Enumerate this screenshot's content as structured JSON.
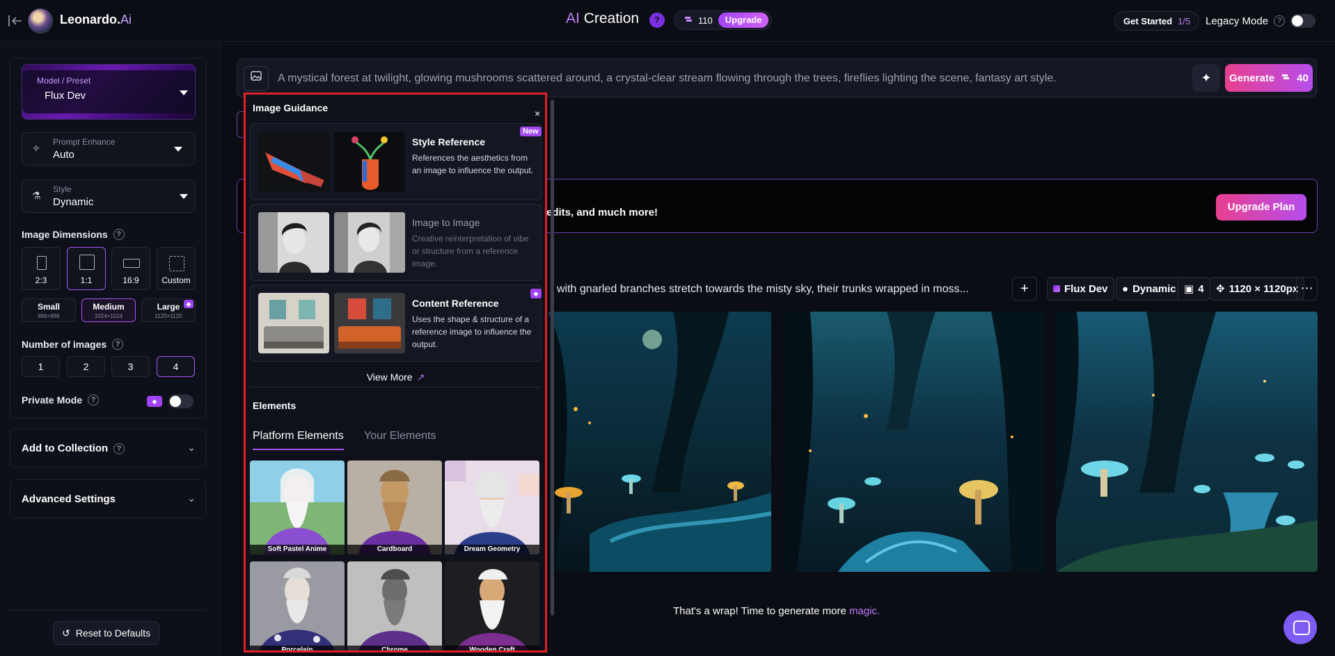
{
  "header": {
    "brand_name": "Leonardo.",
    "brand_ai": "Ai",
    "center_ai": "AI",
    "center_title": "Creation",
    "help_label": "?",
    "token_count": "110",
    "upgrade_label": "Upgrade",
    "get_started_label": "Get Started",
    "get_started_progress": "1/5",
    "legacy_mode_label": "Legacy Mode"
  },
  "sidebar": {
    "model_label": "Model / Preset",
    "model_value": "Flux Dev",
    "prompt_enhance_label": "Prompt Enhance",
    "prompt_enhance_value": "Auto",
    "style_label": "Style",
    "style_value": "Dynamic",
    "image_dimensions_label": "Image Dimensions",
    "aspects": [
      "2:3",
      "1:1",
      "16:9",
      "Custom"
    ],
    "selected_aspect": "1:1",
    "sizes": [
      {
        "name": "Small",
        "dims": "896×896"
      },
      {
        "name": "Medium",
        "dims": "1024×1024"
      },
      {
        "name": "Large",
        "dims": "1120×1120"
      }
    ],
    "selected_size": "Medium",
    "number_of_images_label": "Number of images",
    "numbers": [
      "1",
      "2",
      "3",
      "4"
    ],
    "selected_number": "4",
    "private_mode_label": "Private Mode",
    "add_to_collection_label": "Add to Collection",
    "advanced_settings_label": "Advanced Settings",
    "reset_label": "Reset to Defaults"
  },
  "prompt": {
    "text": "A mystical forest at twilight, glowing mushrooms scattered around, a crystal-clear stream flowing through the trees, fireflies lighting the scene, fantasy art style.",
    "generate_label": "Generate",
    "generate_cost": "40"
  },
  "promo": {
    "text": "edits, and much more!",
    "button_label": "Upgrade Plan"
  },
  "generation": {
    "prompt_text": "with gnarled branches stretch towards the misty sky, their trunks wrapped in moss...",
    "model_chip": "Flux Dev",
    "style_chip": "Dynamic",
    "count_chip": "4",
    "size_chip": "1120 × 1120px",
    "wrap_text": "That's a wrap! Time to generate more ",
    "wrap_link": "magic."
  },
  "popup": {
    "title": "Image Guidance",
    "close_label": "×",
    "cards": [
      {
        "title": "Style Reference",
        "desc": "References the aesthetics from an image to influence the output.",
        "badge": "New"
      },
      {
        "title": "Image to Image",
        "desc": "Creative reinterpretation of vibe or structure from a reference image."
      },
      {
        "title": "Content Reference",
        "desc": "Uses the shape & structure of a reference image to influence the output."
      }
    ],
    "view_more_label": "View More",
    "elements_title": "Elements",
    "tabs": [
      "Platform Elements",
      "Your Elements"
    ],
    "active_tab": "Platform Elements",
    "elements": [
      "Soft Pastel Anime",
      "Cardboard",
      "Dream Geometry",
      "Porcelain",
      "Chrome",
      "Wooden Craft"
    ]
  },
  "colors": {
    "accent": "#a855f7",
    "generate_gradient_start": "#e8408f",
    "generate_gradient_end": "#b64dec",
    "highlight_border": "#e01f27"
  }
}
